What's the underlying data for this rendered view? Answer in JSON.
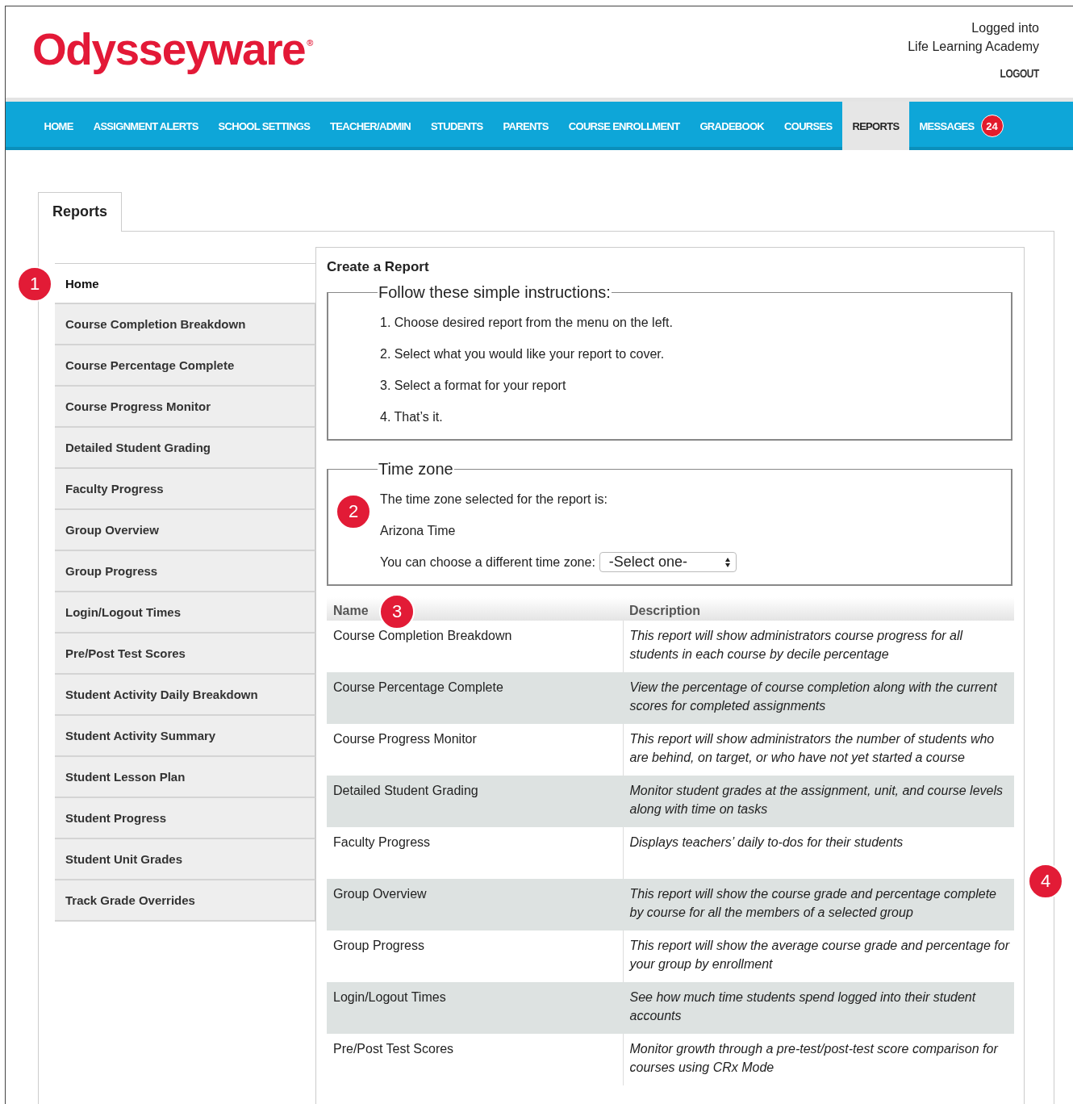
{
  "logo": {
    "name": "Odysseyware",
    "mark": "®"
  },
  "account": {
    "lines": [
      "Logged into",
      "Life Learning Academy"
    ],
    "logout": "LOGOUT"
  },
  "nav": [
    {
      "label": "HOME",
      "selected": false
    },
    {
      "label": "ASSIGNMENT ALERTS",
      "selected": false
    },
    {
      "label": "SCHOOL SETTINGS",
      "selected": false
    },
    {
      "label": "TEACHER/ADMIN",
      "selected": false
    },
    {
      "label": "STUDENTS",
      "selected": false
    },
    {
      "label": "PARENTS",
      "selected": false
    },
    {
      "label": "COURSE ENROLLMENT",
      "selected": false
    },
    {
      "label": "GRADEBOOK",
      "selected": false
    },
    {
      "label": "COURSES",
      "selected": false
    },
    {
      "label": "REPORTS",
      "selected": true
    },
    {
      "label": "MESSAGES",
      "selected": false,
      "badge": "24"
    }
  ],
  "page_tab": "Reports",
  "sidebar": {
    "items": [
      {
        "label": "Home",
        "selected": true
      },
      {
        "label": "Course Completion Breakdown",
        "selected": false
      },
      {
        "label": "Course Percentage Complete",
        "selected": false
      },
      {
        "label": "Course Progress Monitor",
        "selected": false
      },
      {
        "label": "Detailed Student Grading",
        "selected": false
      },
      {
        "label": "Faculty Progress",
        "selected": false
      },
      {
        "label": "Group Overview",
        "selected": false
      },
      {
        "label": "Group Progress",
        "selected": false
      },
      {
        "label": "Login/Logout Times",
        "selected": false
      },
      {
        "label": "Pre/Post Test Scores",
        "selected": false
      },
      {
        "label": "Student Activity Daily Breakdown",
        "selected": false
      },
      {
        "label": "Student Activity Summary",
        "selected": false
      },
      {
        "label": "Student Lesson Plan",
        "selected": false
      },
      {
        "label": "Student Progress",
        "selected": false
      },
      {
        "label": "Student Unit Grades",
        "selected": false
      },
      {
        "label": "Track Grade Overrides",
        "selected": false
      }
    ]
  },
  "main": {
    "title": "Create a Report",
    "instructions": {
      "legend": "Follow these simple instructions:",
      "steps": [
        "1. Choose desired report from the menu on the left.",
        "2. Select what you would like your report to cover.",
        "3. Select a format for your report",
        "4. That’s it."
      ]
    },
    "time_zone": {
      "legend": "Time zone",
      "intro": "The time zone selected for the report is:",
      "current": "Arizona Time",
      "choose_label": "You can choose a different time zone:",
      "select": {
        "value": "-Select one-"
      }
    },
    "table": {
      "columns": [
        "Name",
        "Description"
      ],
      "rows": [
        {
          "name": "Course Completion Breakdown",
          "description": "This report will show administrators course progress for all students in each course by decile percentage"
        },
        {
          "name": "Course Percentage Complete",
          "description": "View the percentage of course completion along with the current scores for completed assignments"
        },
        {
          "name": "Course Progress Monitor",
          "description": "This report will show administrators the number of students who are behind, on target, or who have not yet started a course"
        },
        {
          "name": "Detailed Student Grading",
          "description": "Monitor student grades at the assignment, unit, and course levels along with time on tasks"
        },
        {
          "name": "Faculty Progress",
          "description": "Displays teachers’ daily to-dos for their students"
        },
        {
          "name": "Group Overview",
          "description": "This report will show the course grade and percentage complete by course for all the members of a selected group"
        },
        {
          "name": "Group Progress",
          "description": "This report will show the average course grade and percentage for your group by enrollment"
        },
        {
          "name": "Login/Logout Times",
          "description": "See how much time students spend logged into their student accounts"
        },
        {
          "name": "Pre/Post Test Scores",
          "description": "Monitor growth through a pre-test/post-test score comparison for courses using CRx Mode"
        }
      ]
    }
  },
  "callouts": [
    "1",
    "2",
    "3",
    "4"
  ]
}
